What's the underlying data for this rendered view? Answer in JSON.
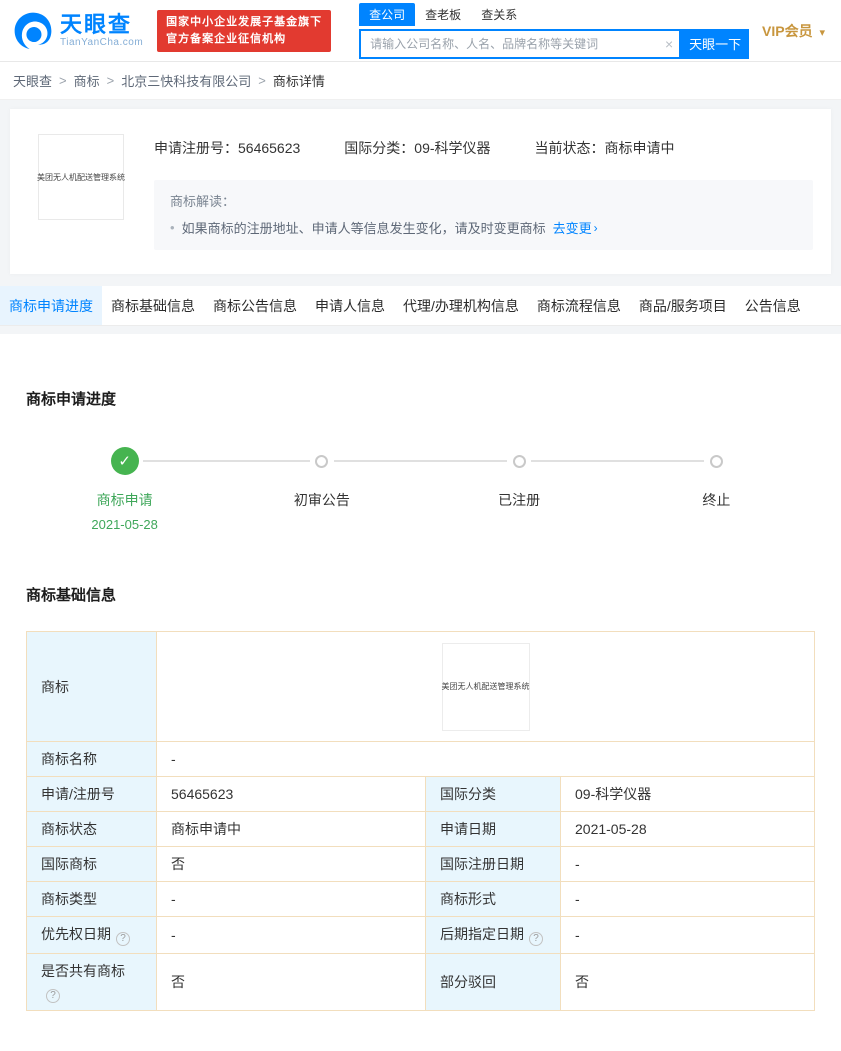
{
  "icons": {
    "clear": "×",
    "caret_down": "▾",
    "check": "✓",
    "help": "?",
    "link_arrow": "›",
    "bullet": "•"
  },
  "header": {
    "logo": {
      "brand": "天眼查",
      "domain": "TianYanCha.com"
    },
    "badge": {
      "line1": "国家中小企业发展子基金旗下",
      "line2": "官方备案企业征信机构"
    },
    "nav_tabs": [
      "查公司",
      "查老板",
      "查关系"
    ],
    "search": {
      "placeholder": "请输入公司名称、人名、品牌名称等关键词",
      "button": "天眼一下"
    },
    "vip": "VIP会员"
  },
  "breadcrumb": {
    "separator": ">",
    "items": [
      "天眼查",
      "商标",
      "北京三快科技有限公司",
      "商标详情"
    ]
  },
  "summary": {
    "trademark_image_text": "美团无人机配送管理系统",
    "fields": [
      {
        "label": "申请注册号：",
        "value": "56465623"
      },
      {
        "label": "国际分类：",
        "value": "09-科学仪器"
      },
      {
        "label": "当前状态：",
        "value": "商标申请中"
      }
    ],
    "interpretation": {
      "title": "商标解读：",
      "tip": "如果商标的注册地址、申请人等信息发生变化，请及时变更商标",
      "link": "去变更"
    }
  },
  "tabs": [
    "商标申请进度",
    "商标基础信息",
    "商标公告信息",
    "申请人信息",
    "代理/办理机构信息",
    "商标流程信息",
    "商品/服务项目",
    "公告信息"
  ],
  "progress": {
    "title": "商标申请进度",
    "steps": [
      {
        "label": "商标申请",
        "date": "2021-05-28"
      },
      {
        "label": "初审公告"
      },
      {
        "label": "已注册"
      },
      {
        "label": "终止"
      }
    ]
  },
  "basic_info": {
    "title": "商标基础信息",
    "trademark_row": {
      "label": "商标",
      "image_text": "美团无人机配送管理系统"
    },
    "rows": [
      {
        "l1": "商标名称",
        "v1": "-"
      },
      {
        "l1": "申请/注册号",
        "v1": "56465623",
        "l2": "国际分类",
        "v2": "09-科学仪器"
      },
      {
        "l1": "商标状态",
        "v1": "商标申请中",
        "l2": "申请日期",
        "v2": "2021-05-28"
      },
      {
        "l1": "国际商标",
        "v1": "否",
        "l2": "国际注册日期",
        "v2": "-"
      },
      {
        "l1": "商标类型",
        "v1": "-",
        "l2": "商标形式",
        "v2": "-"
      },
      {
        "l1": "优先权日期",
        "v1": "-",
        "l2": "后期指定日期",
        "v2": "-"
      },
      {
        "l1": "是否共有商标",
        "v1": "否",
        "l2": "部分驳回",
        "v2": "否"
      }
    ]
  }
}
